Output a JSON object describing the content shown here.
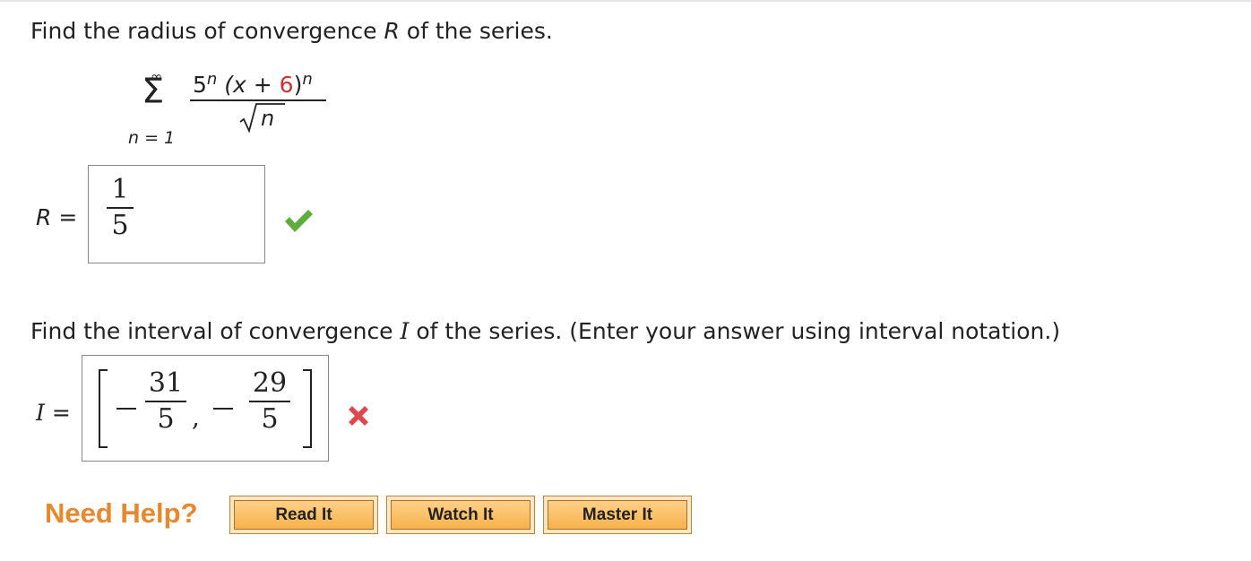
{
  "question1": {
    "text_before": "Find the radius of convergence ",
    "var": "R",
    "text_after": " of the series."
  },
  "series": {
    "upper": "∞",
    "sigma": "Σ",
    "lower": "n = 1",
    "num_base": "5",
    "num_exp": "n",
    "num_open": "(x + ",
    "num_red": "6",
    "num_close": ")",
    "num_exp2": "n",
    "den": "n"
  },
  "answer_r": {
    "label": "R =",
    "numerator": "1",
    "denominator": "5",
    "status": "correct"
  },
  "question2": {
    "text_before": "Find the interval of convergence ",
    "var": "I",
    "text_after": " of the series. (Enter your answer using interval notation.)"
  },
  "answer_i": {
    "label": "I =",
    "left_num": "31",
    "left_den": "5",
    "comma": ",",
    "right_num": "29",
    "right_den": "5",
    "status": "incorrect"
  },
  "help": {
    "label": "Need Help?",
    "buttons": [
      "Read It",
      "Watch It",
      "Master It"
    ]
  },
  "colors": {
    "accent_orange": "#e8872c",
    "correct_green": "#5fae3b",
    "incorrect_red": "#e0474c",
    "highlight_red": "#d32f2f"
  }
}
